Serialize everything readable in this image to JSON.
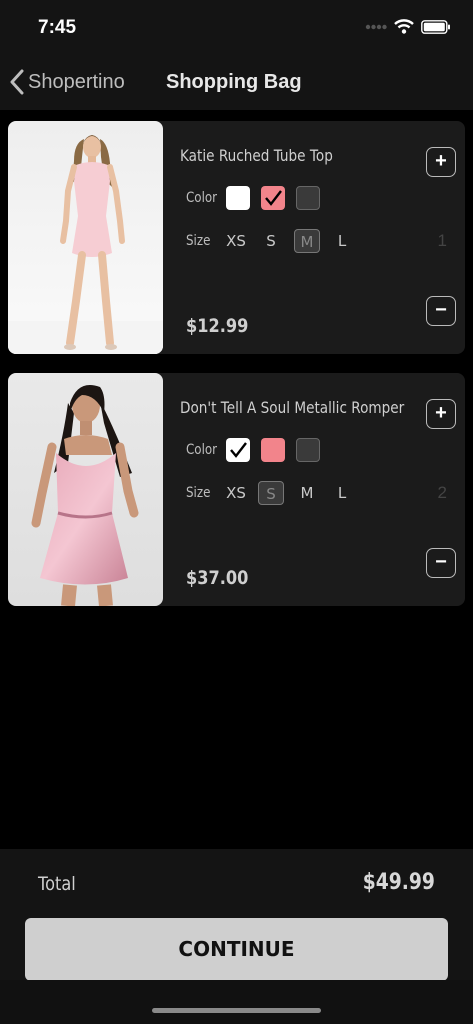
{
  "status": {
    "time": "7:45"
  },
  "nav": {
    "back_label": "Shopertino",
    "title": "Shopping Bag"
  },
  "labels": {
    "color": "Color",
    "size": "Size"
  },
  "items": [
    {
      "name": "Katie Ruched Tube Top",
      "price": "$12.99",
      "quantity": "1",
      "colors": [
        {
          "hex": "#ffffff",
          "checked": false
        },
        {
          "hex": "#f2848b",
          "checked": true
        },
        {
          "hex": "#3a3a3a",
          "checked": false
        }
      ],
      "sizes": [
        "XS",
        "S",
        "M",
        "L"
      ],
      "selected_size": "M"
    },
    {
      "name": "Don't Tell A Soul Metallic Romper",
      "price": "$37.00",
      "quantity": "2",
      "colors": [
        {
          "hex": "#ffffff",
          "checked": true
        },
        {
          "hex": "#f2848b",
          "checked": false
        },
        {
          "hex": "#3a3a3a",
          "checked": false
        }
      ],
      "sizes": [
        "XS",
        "S",
        "M",
        "L"
      ],
      "selected_size": "S"
    }
  ],
  "qty": {
    "plus": "+",
    "minus": "−"
  },
  "footer": {
    "total_label": "Total",
    "total_value": "$49.99",
    "continue_label": "CONTINUE"
  }
}
